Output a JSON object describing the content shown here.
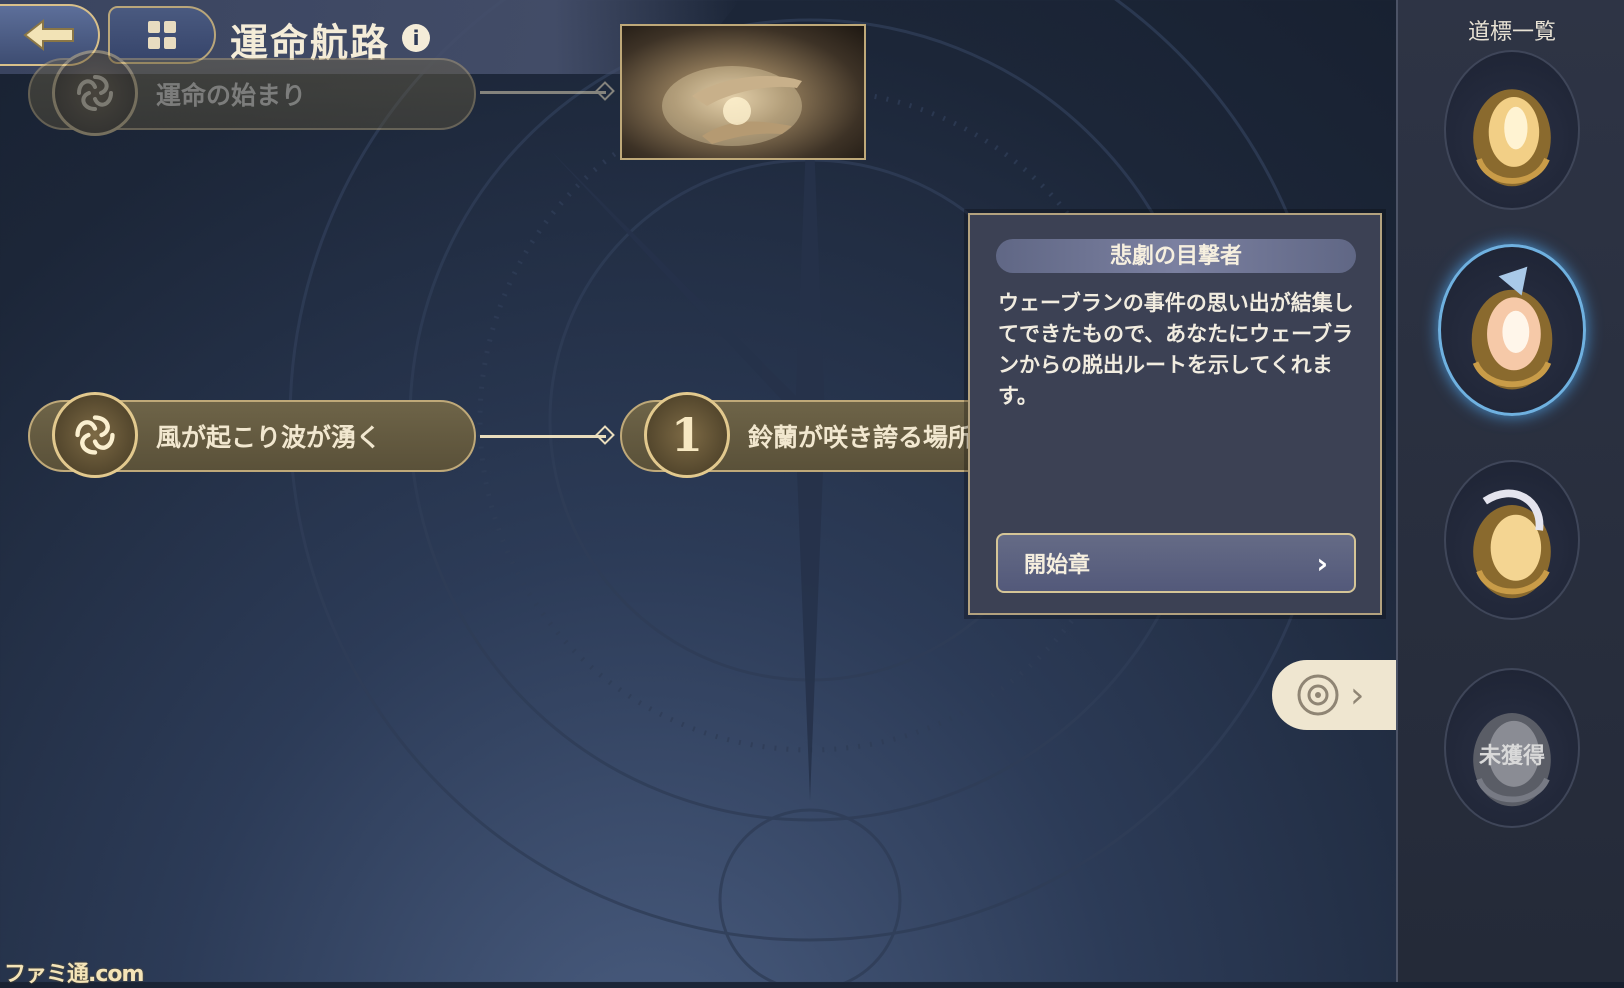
{
  "header": {
    "title": "運命航路",
    "back_icon": "back-arrow-icon",
    "menu_icon": "map-grid-icon",
    "info_icon": "info-icon",
    "info_glyph": "i"
  },
  "route": {
    "nodes": [
      {
        "label": "運命の始まり",
        "badge": "swirl-icon",
        "state": "dim"
      },
      {
        "label": "風が起こり波が湧く",
        "badge": "swirl-icon",
        "state": "active"
      },
      {
        "label": "鈴蘭が咲き誇る場所",
        "badge_number": "1",
        "state": "active"
      }
    ]
  },
  "popup": {
    "title": "悲劇の目撃者",
    "description": "ウェーブランの事件の思い出が結集してできたもので、あなたにウェーブランからの脱出ルートを示してくれます。",
    "chapter_button": "開始章",
    "chevron": "›"
  },
  "side_tab": {
    "icon": "compass-badge-icon",
    "chevron": "›"
  },
  "right_panel": {
    "title": "道標一覧",
    "medals": [
      {
        "name": "medal-1",
        "state": "obtained"
      },
      {
        "name": "medal-2",
        "state": "selected"
      },
      {
        "name": "medal-3",
        "state": "obtained"
      },
      {
        "name": "medal-4",
        "state": "locked",
        "label": "未獲得"
      }
    ]
  },
  "watermark": "ファミ通.com",
  "colors": {
    "gold": "#bfa979",
    "panel": "#3c4154",
    "accent_blue": "#6fb1e0"
  }
}
